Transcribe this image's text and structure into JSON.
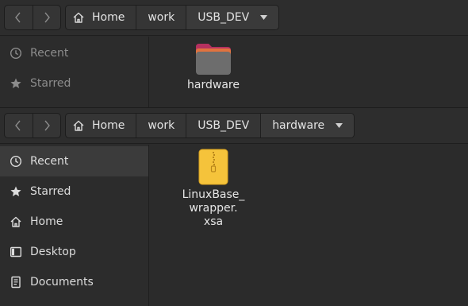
{
  "windows": [
    {
      "breadcrumb": [
        "Home",
        "work",
        "USB_DEV"
      ],
      "sidebar": [
        {
          "label": "Recent",
          "icon": "clock-icon"
        },
        {
          "label": "Starred",
          "icon": "star-icon"
        }
      ],
      "files": [
        {
          "name": "hardware",
          "icon": "folder-icon"
        }
      ]
    },
    {
      "breadcrumb": [
        "Home",
        "work",
        "USB_DEV",
        "hardware"
      ],
      "sidebar": [
        {
          "label": "Recent",
          "icon": "clock-icon",
          "selected": true
        },
        {
          "label": "Starred",
          "icon": "star-icon"
        },
        {
          "label": "Home",
          "icon": "home-icon"
        },
        {
          "label": "Desktop",
          "icon": "desktop-icon"
        },
        {
          "label": "Documents",
          "icon": "documents-icon"
        }
      ],
      "files": [
        {
          "name_lines": [
            "LinuxBase_",
            "wrapper.",
            "xsa"
          ],
          "icon": "zip-archive-icon"
        }
      ]
    }
  ],
  "colors": {
    "folder_tab": "#b5315f",
    "folder_back": "#e0733f",
    "folder_front": "#6d6d6d",
    "archive": "#f5c33b"
  }
}
